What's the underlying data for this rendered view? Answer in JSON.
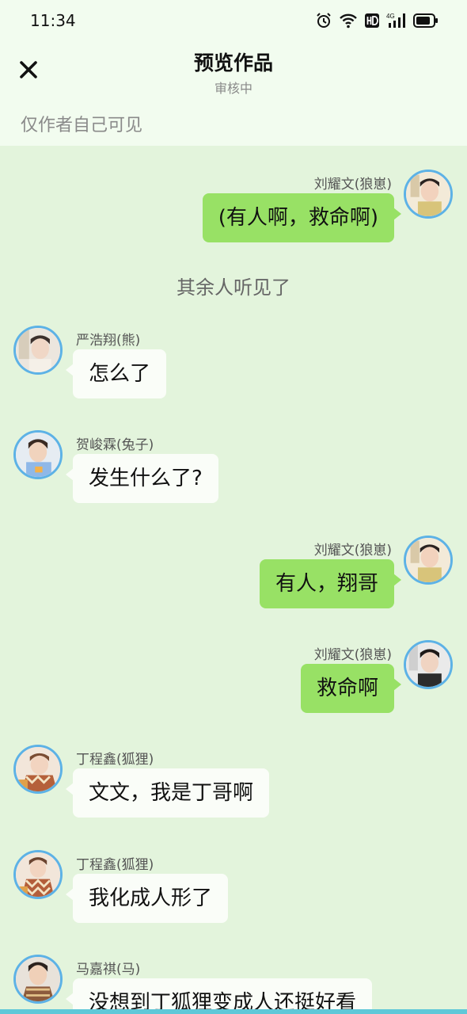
{
  "status_bar": {
    "time": "11:34",
    "icons": [
      "alarm-icon",
      "wifi-icon",
      "hd-icon",
      "4g-signal-icon",
      "battery-icon"
    ]
  },
  "header": {
    "title": "预览作品",
    "subtitle": "审核中",
    "visibility_note": "仅作者自己可见"
  },
  "colors": {
    "header_bg": "#f2fcef",
    "chat_bg": "#e3f4dc",
    "own_bubble": "#98e165",
    "other_bubble": "#fafdf8",
    "avatar_ring": "#5db2e6"
  },
  "messages": [
    {
      "side": "right",
      "sender": "刘耀文(狼崽)",
      "text": "(有人啊，救命啊)"
    },
    {
      "side": "center",
      "text": "其余人听见了"
    },
    {
      "side": "left",
      "sender": "严浩翔(熊)",
      "text": "怎么了"
    },
    {
      "side": "left",
      "sender": "贺峻霖(兔子)",
      "text": "发生什么了?"
    },
    {
      "side": "right",
      "sender": "刘耀文(狼崽)",
      "text": "有人，翔哥"
    },
    {
      "side": "right",
      "sender": "刘耀文(狼崽)",
      "text": "救命啊"
    },
    {
      "side": "left",
      "sender": "丁程鑫(狐狸)",
      "text": "文文，我是丁哥啊"
    },
    {
      "side": "left",
      "sender": "丁程鑫(狐狸)",
      "text": "我化成人形了"
    },
    {
      "side": "left",
      "sender": "马嘉祺(马)",
      "text": "没想到丁狐狸变成人还挺好看"
    }
  ]
}
